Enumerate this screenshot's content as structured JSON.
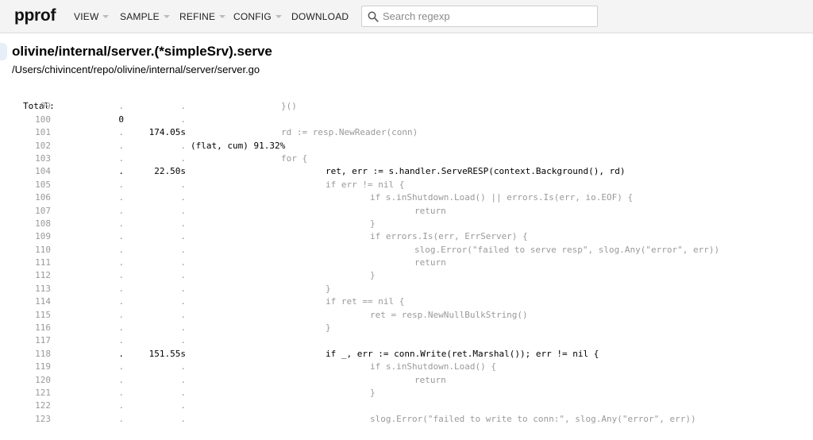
{
  "header": {
    "brand": "pprof",
    "menus": [
      {
        "label": "VIEW",
        "has_caret": true
      },
      {
        "label": "SAMPLE",
        "has_caret": true
      },
      {
        "label": "REFINE",
        "has_caret": true
      },
      {
        "label": "CONFIG",
        "has_caret": true
      },
      {
        "label": "DOWNLOAD",
        "has_caret": false
      }
    ],
    "search_placeholder": "Search regexp",
    "search_value": ""
  },
  "source": {
    "function_name": "olivine/internal/server.(*simpleSrv).serve",
    "file_path": "/Users/chivincent/repo/olivine/internal/server/server.go",
    "total_label": "Total:",
    "total_flat": "0",
    "total_cum": "174.05s",
    "total_suffix": "(flat, cum) 91.32%",
    "lines": [
      {
        "n": "99",
        "flat": ".",
        "cum": ".",
        "indent": 2,
        "code": "}()",
        "hot": false
      },
      {
        "n": "100",
        "flat": ".",
        "cum": ".",
        "indent": 0,
        "code": "",
        "hot": false
      },
      {
        "n": "101",
        "flat": ".",
        "cum": ".",
        "indent": 2,
        "code": "rd := resp.NewReader(conn)",
        "hot": false
      },
      {
        "n": "102",
        "flat": ".",
        "cum": ".",
        "indent": 0,
        "code": "",
        "hot": false
      },
      {
        "n": "103",
        "flat": ".",
        "cum": ".",
        "indent": 2,
        "code": "for {",
        "hot": false
      },
      {
        "n": "104",
        "flat": ".",
        "cum": "22.50s",
        "indent": 3,
        "code": "ret, err := s.handler.ServeRESP(context.Background(), rd)",
        "hot": true
      },
      {
        "n": "105",
        "flat": ".",
        "cum": ".",
        "indent": 3,
        "code": "if err != nil {",
        "hot": false
      },
      {
        "n": "106",
        "flat": ".",
        "cum": ".",
        "indent": 4,
        "code": "if s.inShutdown.Load() || errors.Is(err, io.EOF) {",
        "hot": false
      },
      {
        "n": "107",
        "flat": ".",
        "cum": ".",
        "indent": 5,
        "code": "return",
        "hot": false
      },
      {
        "n": "108",
        "flat": ".",
        "cum": ".",
        "indent": 4,
        "code": "}",
        "hot": false
      },
      {
        "n": "109",
        "flat": ".",
        "cum": ".",
        "indent": 4,
        "code": "if errors.Is(err, ErrServer) {",
        "hot": false
      },
      {
        "n": "110",
        "flat": ".",
        "cum": ".",
        "indent": 5,
        "code": "slog.Error(\"failed to serve resp\", slog.Any(\"error\", err))",
        "hot": false
      },
      {
        "n": "111",
        "flat": ".",
        "cum": ".",
        "indent": 5,
        "code": "return",
        "hot": false
      },
      {
        "n": "112",
        "flat": ".",
        "cum": ".",
        "indent": 4,
        "code": "}",
        "hot": false
      },
      {
        "n": "113",
        "flat": ".",
        "cum": ".",
        "indent": 3,
        "code": "}",
        "hot": false
      },
      {
        "n": "114",
        "flat": ".",
        "cum": ".",
        "indent": 3,
        "code": "if ret == nil {",
        "hot": false
      },
      {
        "n": "115",
        "flat": ".",
        "cum": ".",
        "indent": 4,
        "code": "ret = resp.NewNullBulkString()",
        "hot": false
      },
      {
        "n": "116",
        "flat": ".",
        "cum": ".",
        "indent": 3,
        "code": "}",
        "hot": false
      },
      {
        "n": "117",
        "flat": ".",
        "cum": ".",
        "indent": 0,
        "code": "",
        "hot": false
      },
      {
        "n": "118",
        "flat": ".",
        "cum": "151.55s",
        "indent": 3,
        "code": "if _, err := conn.Write(ret.Marshal()); err != nil {",
        "hot": true
      },
      {
        "n": "119",
        "flat": ".",
        "cum": ".",
        "indent": 4,
        "code": "if s.inShutdown.Load() {",
        "hot": false
      },
      {
        "n": "120",
        "flat": ".",
        "cum": ".",
        "indent": 5,
        "code": "return",
        "hot": false
      },
      {
        "n": "121",
        "flat": ".",
        "cum": ".",
        "indent": 4,
        "code": "}",
        "hot": false
      },
      {
        "n": "122",
        "flat": ".",
        "cum": ".",
        "indent": 0,
        "code": "",
        "hot": false
      },
      {
        "n": "123",
        "flat": ".",
        "cum": ".",
        "indent": 4,
        "code": "slog.Error(\"failed to write to conn:\", slog.Any(\"error\", err))",
        "hot": false
      }
    ]
  }
}
